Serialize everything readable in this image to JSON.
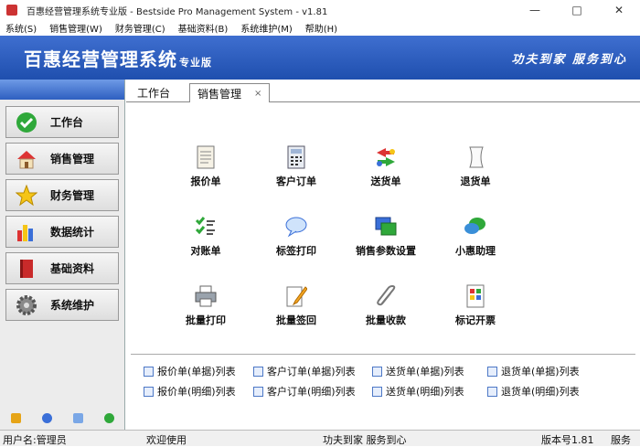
{
  "window": {
    "title": "百惠经营管理系统专业版 - Bestside Pro Management System - v1.81",
    "minimize": "—",
    "maximize": "□",
    "close": "✕"
  },
  "menu": [
    "系统(S)",
    "销售管理(W)",
    "财务管理(C)",
    "基础资料(B)",
    "系统维护(M)",
    "帮助(H)"
  ],
  "banner": {
    "title": "百惠经营管理系统",
    "edition": "专业版",
    "slogan": "功夫到家 服务到心"
  },
  "sidebar": {
    "items": [
      {
        "label": "工作台",
        "icon": "checkmark-icon"
      },
      {
        "label": "销售管理",
        "icon": "house-icon"
      },
      {
        "label": "财务管理",
        "icon": "star-icon"
      },
      {
        "label": "数据统计",
        "icon": "bar-chart-icon"
      },
      {
        "label": "基础资料",
        "icon": "book-icon"
      },
      {
        "label": "系统维护",
        "icon": "gear-icon"
      }
    ]
  },
  "tabs": [
    {
      "label": "工作台"
    },
    {
      "label": "销售管理",
      "close": "×"
    }
  ],
  "functions": [
    {
      "label": "报价单",
      "icon": "document-icon"
    },
    {
      "label": "客户订单",
      "icon": "calculator-icon"
    },
    {
      "label": "送货单",
      "icon": "exchange-icon"
    },
    {
      "label": "退货单",
      "icon": "scroll-icon"
    },
    {
      "label": "对账单",
      "icon": "checklist-icon"
    },
    {
      "label": "标签打印",
      "icon": "speech-bubble-icon"
    },
    {
      "label": "销售参数设置",
      "icon": "windows-icon"
    },
    {
      "label": "小惠助理",
      "icon": "chat-icon"
    },
    {
      "label": "批量打印",
      "icon": "printer-icon"
    },
    {
      "label": "批量签回",
      "icon": "pencil-icon"
    },
    {
      "label": "批量收款",
      "icon": "paperclip-icon"
    },
    {
      "label": "标记开票",
      "icon": "invoice-icon"
    }
  ],
  "lists": [
    "报价单(单据)列表",
    "客户订单(单据)列表",
    "送货单(单据)列表",
    "退货单(单据)列表",
    "报价单(明细)列表",
    "客户订单(明细)列表",
    "送货单(明细)列表",
    "退货单(明细)列表"
  ],
  "status": {
    "user": "用户名:管理员",
    "welcome": "欢迎使用",
    "slogan": "功夫到家 服务到心",
    "version": "版本号1.81",
    "service": "服务"
  }
}
